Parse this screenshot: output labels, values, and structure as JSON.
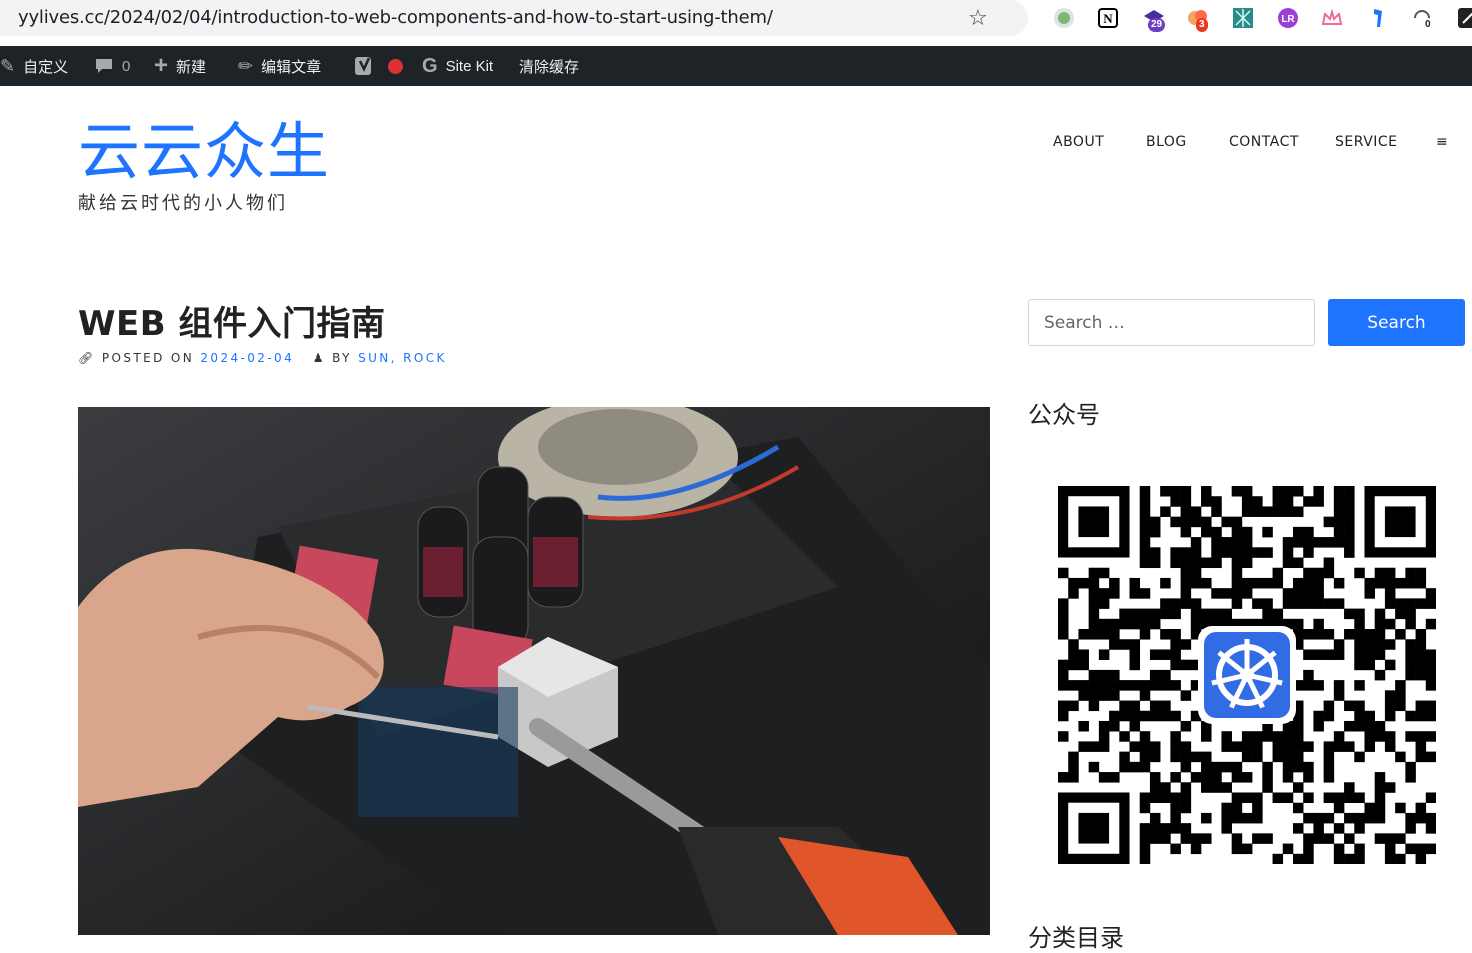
{
  "browser": {
    "url": "yylives.cc/2024/02/04/introduction-to-web-components-and-how-to-start-using-them/",
    "extension_badges": [
      "29",
      "3",
      "0"
    ]
  },
  "admin_bar": {
    "customize": "自定义",
    "comments_count": "0",
    "new": "新建",
    "edit": "编辑文章",
    "sitekit": "Site Kit",
    "clear_cache": "清除缓存"
  },
  "site": {
    "title": "云云众生",
    "description": "献给云时代的小人物们"
  },
  "nav": {
    "items": [
      "ABOUT",
      "BLOG",
      "CONTACT",
      "SERVICE"
    ],
    "menu_toggle": "≡"
  },
  "post": {
    "title": "WEB 组件入门指南",
    "posted_on_label": "POSTED ON",
    "date": "2024-02-04",
    "by_label": "BY",
    "authors": "SUN, ROCK"
  },
  "sidebar": {
    "search_placeholder": "Search …",
    "search_button": "Search",
    "widget1_title": "公众号",
    "widget2_title": "分类目录"
  },
  "colors": {
    "accent": "#1e73ff",
    "admin_bar_bg": "#1d2327"
  }
}
